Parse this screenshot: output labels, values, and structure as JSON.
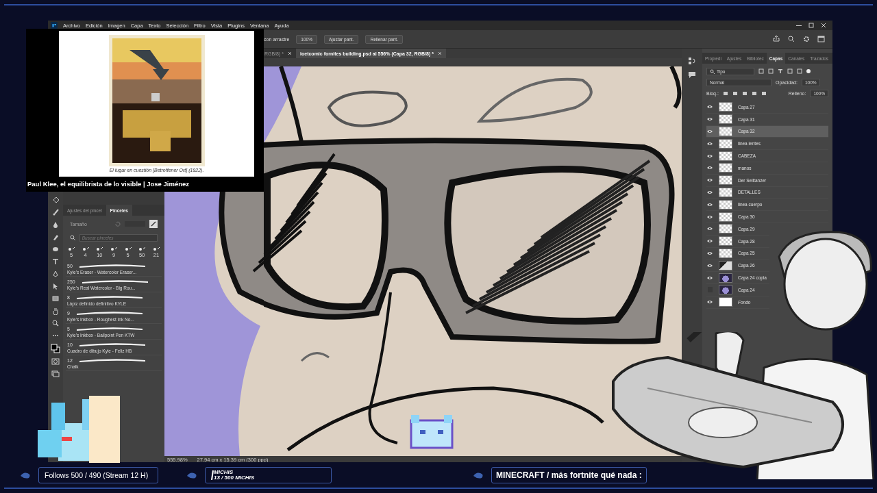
{
  "menu_bar": [
    "Archivo",
    "Edición",
    "Imagen",
    "Capa",
    "Texto",
    "Selección",
    "Filtro",
    "Vista",
    "Plugins",
    "Ventana",
    "Ayuda"
  ],
  "options_bar": {
    "drag_label": "con arrastre",
    "zoom": "100%",
    "buttons": [
      "Ajustar pant.",
      "Rellenar pant."
    ]
  },
  "document_tabs": [
    {
      "title": "RGB/8) *",
      "selected": false
    },
    {
      "title": "ioetcomic fornites building.psd al 556% (Capa 32, RGB/8) *",
      "selected": true
    }
  ],
  "status_bar": {
    "zoom": "555.98%",
    "size": "27.94 cm x 15.39 cm (300 ppp)"
  },
  "brushes_panel": {
    "tabs": [
      {
        "label": "Ajustes del pincel",
        "selected": false
      },
      {
        "label": "Pinceles",
        "selected": true
      }
    ],
    "size_label": "Tamaño",
    "search": {
      "placeholder": "Buscar pinceles"
    },
    "presets": [
      "5",
      "4",
      "10",
      "9",
      "5",
      "50",
      "21"
    ],
    "brushes": [
      {
        "size": "50",
        "name": "Kyle's Eraser - Watercolor Eraser..."
      },
      {
        "size": "250",
        "name": "Kyle's Real Watercolor - Big Rou..."
      },
      {
        "size": "8",
        "name": "Lápiz definido definitivo KYLE"
      },
      {
        "size": "9",
        "name": "Kyle's Inkbox - Roughest Ink No..."
      },
      {
        "size": "5",
        "name": "Kyle's Inkbox - Ballpoint Pen KTW"
      },
      {
        "size": "10",
        "name": "Cuadro de dibujo Kyle - Feliz HB"
      },
      {
        "size": "12",
        "name": "Chalk"
      }
    ]
  },
  "layers_panel": {
    "tabs": [
      {
        "label": "Propiedi",
        "selected": false
      },
      {
        "label": "Ajustes",
        "selected": false
      },
      {
        "label": "Bibliotec",
        "selected": false
      },
      {
        "label": "Capas",
        "selected": true
      },
      {
        "label": "Canales",
        "selected": false
      },
      {
        "label": "Trazados",
        "selected": false
      }
    ],
    "filter": "Tipo",
    "blend_mode": "Normal",
    "opacity_label": "Opacidad:",
    "opacity": "100%",
    "lock_label": "Bloq.:",
    "fill_label": "Relleno:",
    "fill": "100%",
    "layers": [
      {
        "name": "Capa 27",
        "visible": true,
        "selected": false,
        "kind": "transparent"
      },
      {
        "name": "Capa 31",
        "visible": true,
        "selected": false,
        "kind": "transparent"
      },
      {
        "name": "Capa 32",
        "visible": true,
        "selected": true,
        "kind": "transparent"
      },
      {
        "name": "linea lentes",
        "visible": true,
        "selected": false,
        "kind": "transparent"
      },
      {
        "name": "CABEZA",
        "visible": true,
        "selected": false,
        "kind": "transparent"
      },
      {
        "name": "manos",
        "visible": true,
        "selected": false,
        "kind": "transparent"
      },
      {
        "name": "Der Seiltanzer",
        "visible": true,
        "selected": false,
        "kind": "transparent"
      },
      {
        "name": "DETALLES",
        "visible": true,
        "selected": false,
        "kind": "transparent"
      },
      {
        "name": "linea cuerpo",
        "visible": true,
        "selected": false,
        "kind": "transparent"
      },
      {
        "name": "Capa 30",
        "visible": true,
        "selected": false,
        "kind": "transparent"
      },
      {
        "name": "Capa 29",
        "visible": true,
        "selected": false,
        "kind": "transparent"
      },
      {
        "name": "Capa 28",
        "visible": true,
        "selected": false,
        "kind": "transparent"
      },
      {
        "name": "Capa 25",
        "visible": true,
        "selected": false,
        "kind": "transparent"
      },
      {
        "name": "Capa 26",
        "visible": true,
        "selected": false,
        "kind": "dark"
      },
      {
        "name": "Capa 24 copia",
        "visible": true,
        "selected": false,
        "kind": "purple"
      },
      {
        "name": "Capa 24",
        "visible": false,
        "selected": false,
        "kind": "purple"
      },
      {
        "name": "Fondo",
        "visible": true,
        "selected": false,
        "kind": "background"
      }
    ]
  },
  "video_overlay": {
    "caption": "El lugar en cuestión [Betroffener Ort] (1922).",
    "title": "Paul Klee, el equilibrista de lo visible | Jose Jiménez"
  },
  "stream_bar": {
    "follows": "Follows 500 / 490 (Stream 12 H)",
    "michis_label": "MICHIS",
    "michis_count": "13 / 500 MICHIS",
    "title": "MINECRAFT / más fortnite qué nada :"
  }
}
